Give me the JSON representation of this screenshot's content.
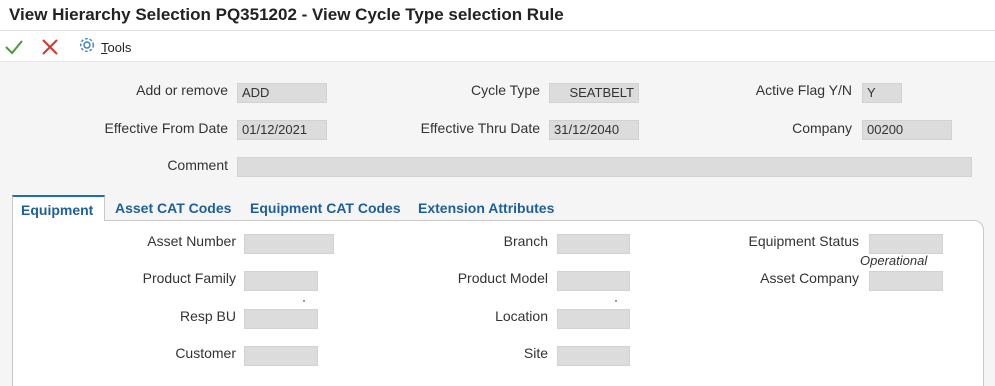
{
  "title": "View Hierarchy Selection PQ351202 - View Cycle Type selection Rule",
  "toolbar": {
    "ok_icon": "checkmark-icon",
    "cancel_icon": "close-icon",
    "tools_icon": "gear-icon",
    "tools_label_underlined": "T",
    "tools_label_rest": "ools"
  },
  "header": {
    "add_remove": {
      "label": "Add or remove",
      "value": "ADD"
    },
    "cycle_type": {
      "label": "Cycle Type",
      "value": "SEATBELT"
    },
    "active_flag": {
      "label": "Active Flag Y/N",
      "value": "Y"
    },
    "effective_from": {
      "label": "Effective From Date",
      "value": "01/12/2021"
    },
    "effective_thru": {
      "label": "Effective Thru Date",
      "value": "31/12/2040"
    },
    "company": {
      "label": "Company",
      "value": "00200"
    },
    "comment": {
      "label": "Comment",
      "value": ""
    }
  },
  "tabs": [
    {
      "label": "Equipment",
      "active": true
    },
    {
      "label": "Asset CAT Codes",
      "active": false
    },
    {
      "label": "Equipment CAT Codes",
      "active": false
    },
    {
      "label": "Extension Attributes",
      "active": false
    }
  ],
  "equipment": {
    "asset_number": {
      "label": "Asset Number",
      "value": ""
    },
    "branch": {
      "label": "Branch",
      "value": ""
    },
    "equipment_status": {
      "label": "Equipment Status",
      "value": "",
      "description": "Operational"
    },
    "product_family": {
      "label": "Product Family",
      "value": ""
    },
    "product_model": {
      "label": "Product Model",
      "value": ""
    },
    "asset_company": {
      "label": "Asset Company",
      "value": ""
    },
    "resp_bu": {
      "label": "Resp BU",
      "value": ""
    },
    "location": {
      "label": "Location",
      "value": ""
    },
    "customer": {
      "label": "Customer",
      "value": ""
    },
    "site": {
      "label": "Site",
      "value": ""
    }
  },
  "colors": {
    "accent": "#1f5f99",
    "ok": "#4a9a3d",
    "cancel": "#d9342b",
    "field_bg": "#dcdcdc"
  }
}
